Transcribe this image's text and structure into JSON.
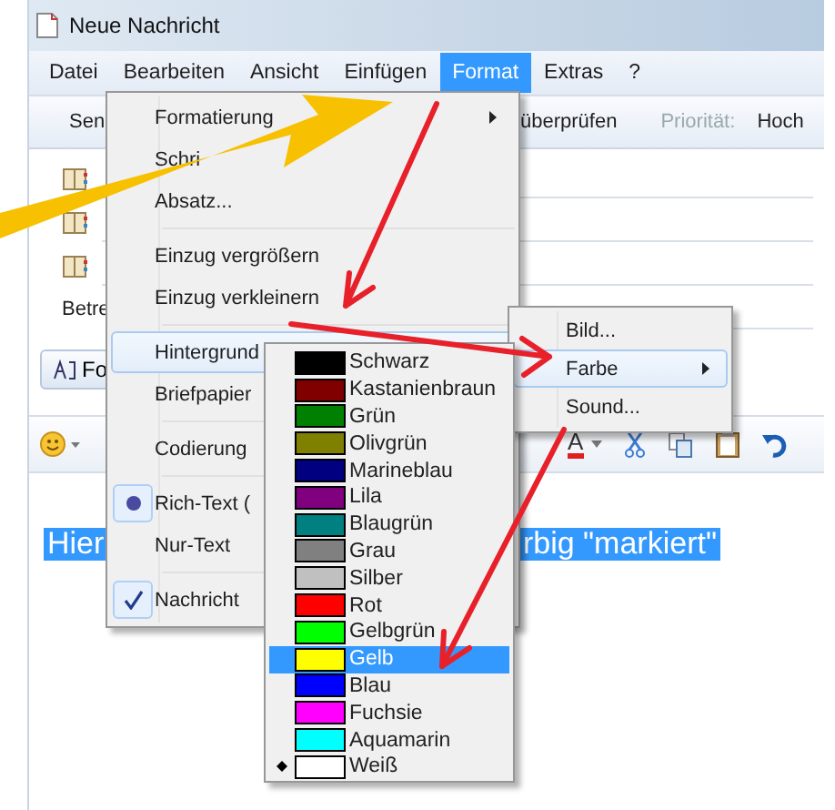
{
  "window": {
    "title": "Neue Nachricht"
  },
  "menubar": [
    {
      "label": "Datei",
      "selected": false
    },
    {
      "label": "Bearbeiten",
      "selected": false
    },
    {
      "label": "Ansicht",
      "selected": false
    },
    {
      "label": "Einfügen",
      "selected": false
    },
    {
      "label": "Format",
      "selected": true
    },
    {
      "label": "Extras",
      "selected": false
    },
    {
      "label": "?",
      "selected": false
    }
  ],
  "toolbar": [
    {
      "label": "Sen",
      "kind": "button"
    },
    {
      "label": "überprüfen",
      "kind": "button"
    },
    {
      "label": "Priorität:",
      "kind": "muted"
    },
    {
      "label": "Hoch",
      "kind": "button"
    }
  ],
  "header": {
    "subject_label": "Betre"
  },
  "format_button": {
    "label": "Fo"
  },
  "format_toolbar": {
    "font_color": "A"
  },
  "body": {
    "segments": [
      "Hier",
      "rbig \"markiert\""
    ]
  },
  "format_menu": [
    {
      "kind": "item",
      "label": "Formatierung",
      "submenu": true,
      "selected": false,
      "checked": false
    },
    {
      "kind": "item",
      "label": "Schri",
      "submenu": false,
      "selected": false,
      "checked": false
    },
    {
      "kind": "item",
      "label": "Absatz...",
      "submenu": false,
      "selected": false,
      "checked": false
    },
    {
      "kind": "separator"
    },
    {
      "kind": "item",
      "label": "Einzug vergrößern",
      "submenu": false,
      "selected": false,
      "checked": false
    },
    {
      "kind": "item",
      "label": "Einzug verkleinern",
      "submenu": false,
      "selected": false,
      "checked": false
    },
    {
      "kind": "separator"
    },
    {
      "kind": "item",
      "label": "Hintergrund",
      "submenu": true,
      "selected": true,
      "checked": false
    },
    {
      "kind": "item",
      "label": "Briefpapier",
      "submenu": false,
      "selected": false,
      "checked": false
    },
    {
      "kind": "separator"
    },
    {
      "kind": "item",
      "label": "Codierung",
      "submenu": false,
      "selected": false,
      "checked": false
    },
    {
      "kind": "separator"
    },
    {
      "kind": "radio",
      "label": "Rich-Text (",
      "submenu": false,
      "selected": false,
      "checked": true
    },
    {
      "kind": "radio",
      "label": "Nur-Text",
      "submenu": false,
      "selected": false,
      "checked": false
    },
    {
      "kind": "separator"
    },
    {
      "kind": "check",
      "label": "Nachricht",
      "submenu": false,
      "selected": false,
      "checked": true
    }
  ],
  "background_menu": [
    {
      "label": "Bild...",
      "submenu": false,
      "selected": false
    },
    {
      "label": "Farbe",
      "submenu": true,
      "selected": true
    },
    {
      "label": "Sound...",
      "submenu": false,
      "selected": false
    }
  ],
  "color_menu": [
    {
      "label": "Schwarz",
      "color": "#000000",
      "selected": false,
      "current": false
    },
    {
      "label": "Kastanienbraun",
      "color": "#800000",
      "selected": false,
      "current": false
    },
    {
      "label": "Grün",
      "color": "#008000",
      "selected": false,
      "current": false
    },
    {
      "label": "Olivgrün",
      "color": "#808000",
      "selected": false,
      "current": false
    },
    {
      "label": "Marineblau",
      "color": "#000080",
      "selected": false,
      "current": false
    },
    {
      "label": "Lila",
      "color": "#800080",
      "selected": false,
      "current": false
    },
    {
      "label": "Blaugrün",
      "color": "#008080",
      "selected": false,
      "current": false
    },
    {
      "label": "Grau",
      "color": "#808080",
      "selected": false,
      "current": false
    },
    {
      "label": "Silber",
      "color": "#c0c0c0",
      "selected": false,
      "current": false
    },
    {
      "label": "Rot",
      "color": "#ff0000",
      "selected": false,
      "current": false
    },
    {
      "label": "Gelbgrün",
      "color": "#00ff00",
      "selected": false,
      "current": false
    },
    {
      "label": "Gelb",
      "color": "#ffff00",
      "selected": true,
      "current": false
    },
    {
      "label": "Blau",
      "color": "#0000ff",
      "selected": false,
      "current": false
    },
    {
      "label": "Fuchsie",
      "color": "#ff00ff",
      "selected": false,
      "current": false
    },
    {
      "label": "Aquamarin",
      "color": "#00ffff",
      "selected": false,
      "current": false
    },
    {
      "label": "Weiß",
      "color": "#ffffff",
      "selected": false,
      "current": true
    }
  ]
}
